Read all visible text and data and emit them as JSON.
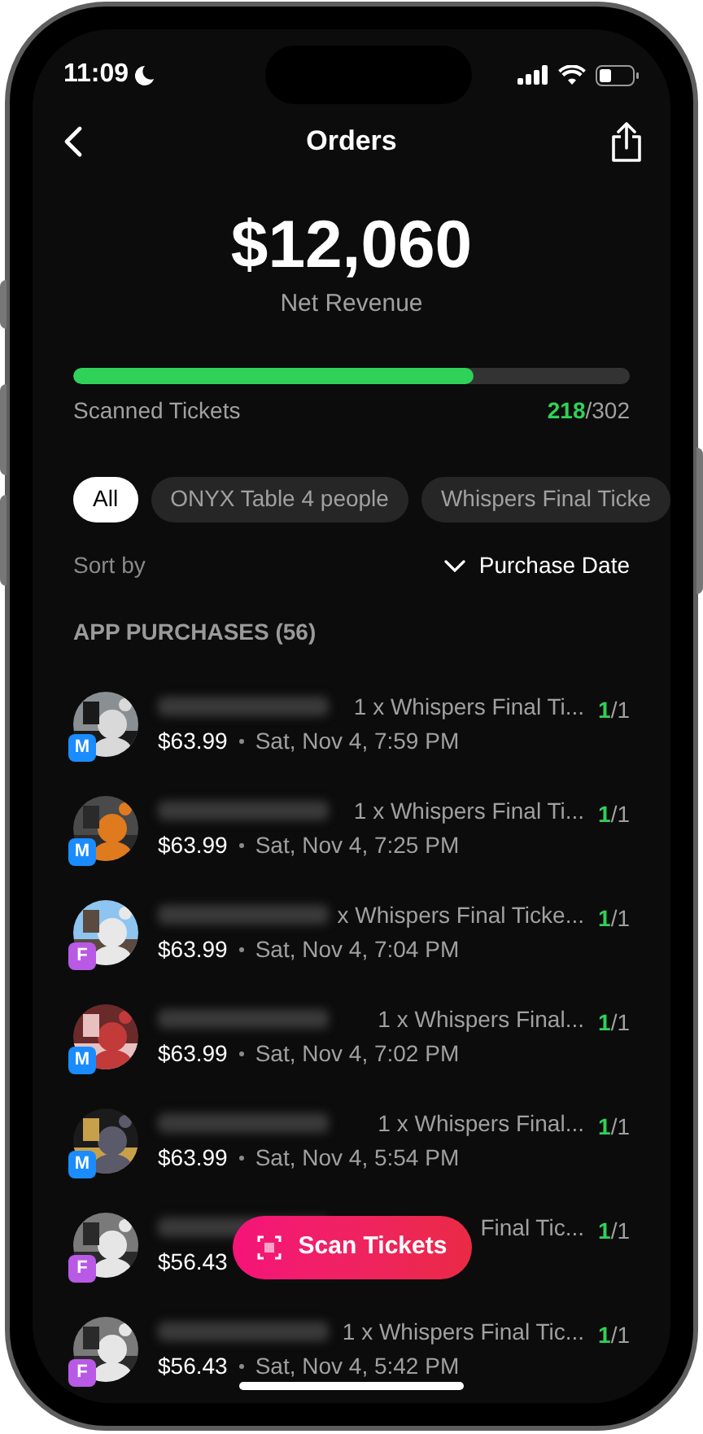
{
  "status_bar": {
    "time": "11:09"
  },
  "nav": {
    "title": "Orders"
  },
  "revenue": {
    "amount": "$12,060",
    "label": "Net Revenue"
  },
  "scanned": {
    "label": "Scanned Tickets",
    "level": 0.72,
    "count": "218",
    "total": "/302"
  },
  "filters": [
    {
      "label": "All",
      "selected": true
    },
    {
      "label": "ONYX Table 4 people",
      "selected": false
    },
    {
      "label": "Whispers Final Ticke",
      "selected": false
    }
  ],
  "sort": {
    "label": "Sort by",
    "value": "Purchase Date"
  },
  "section": {
    "title": "APP PURCHASES (56)"
  },
  "orders": [
    {
      "badge": "M",
      "color": "#1a8cff",
      "ticket": "1 x Whispers Final Ti...",
      "price": "$63.99",
      "date": "Sat, Nov 4, 7:59 PM",
      "count": "1",
      "total": "/1"
    },
    {
      "badge": "M",
      "color": "#1a8cff",
      "ticket": "1 x Whispers Final Ti...",
      "price": "$63.99",
      "date": "Sat, Nov 4, 7:25 PM",
      "count": "1",
      "total": "/1"
    },
    {
      "badge": "F",
      "color": "#b95ae6",
      "ticket": "x Whispers Final Ticke...",
      "price": "$63.99",
      "date": "Sat, Nov 4, 7:04 PM",
      "count": "1",
      "total": "/1"
    },
    {
      "badge": "M",
      "color": "#1a8cff",
      "ticket": "1 x Whispers Final...",
      "price": "$63.99",
      "date": "Sat, Nov 4, 7:02 PM",
      "count": "1",
      "total": "/1"
    },
    {
      "badge": "M",
      "color": "#1a8cff",
      "ticket": "1 x Whispers Final...",
      "price": "$63.99",
      "date": "Sat, Nov 4, 5:54 PM",
      "count": "1",
      "total": "/1"
    },
    {
      "badge": "F",
      "color": "#b95ae6",
      "ticket": "Final Tic...",
      "price": "$56.43",
      "count": "1",
      "total": "/1"
    },
    {
      "badge": "F",
      "color": "#b95ae6",
      "ticket": "1 x Whispers Final Tic...",
      "price": "$56.43",
      "date": "Sat, Nov 4, 5:42 PM",
      "count": "1",
      "total": "/1"
    }
  ],
  "scan_button": {
    "label": "Scan Tickets"
  }
}
